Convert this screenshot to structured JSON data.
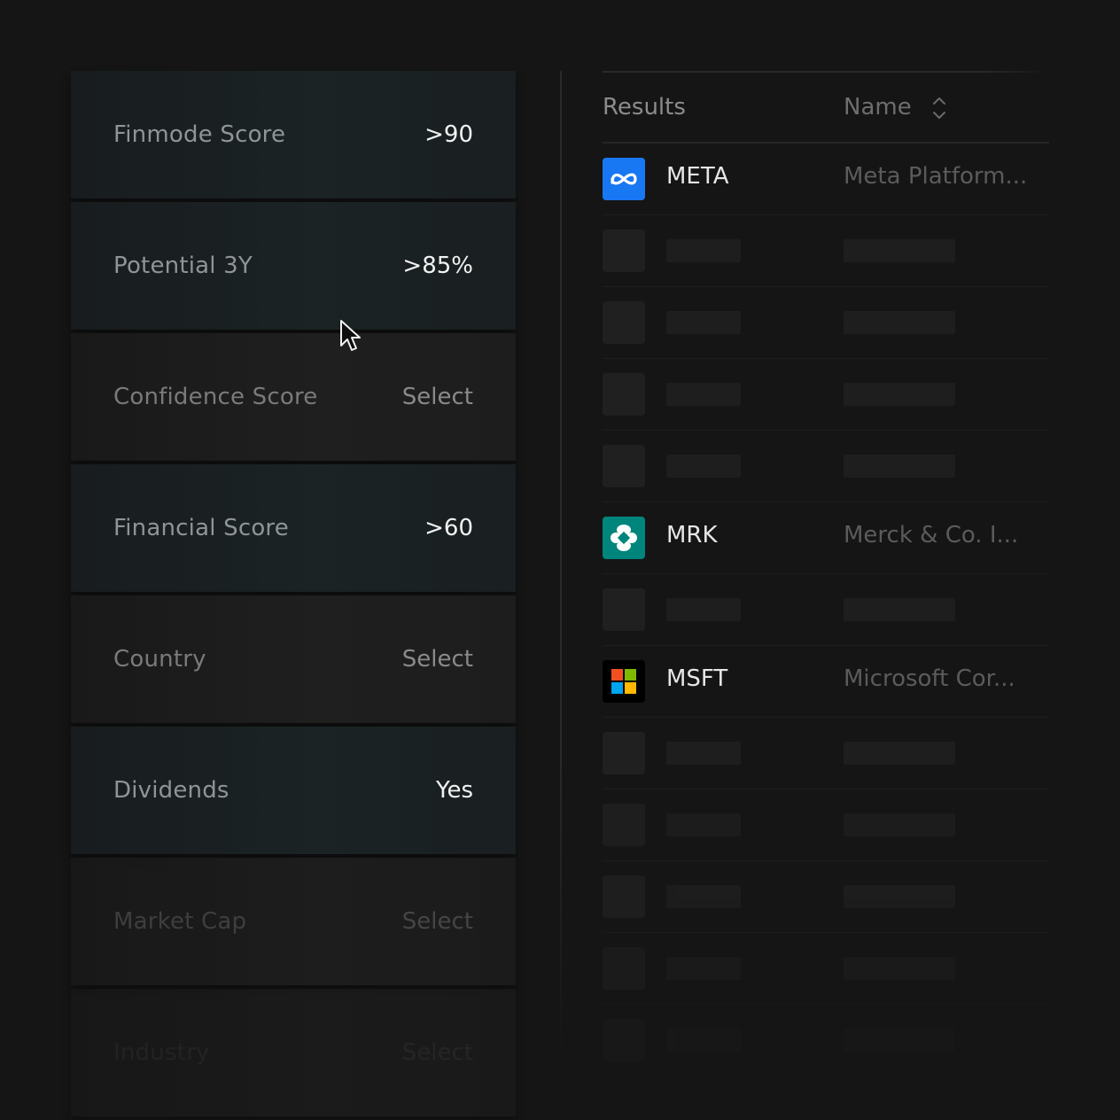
{
  "filters": [
    {
      "label": "Finmode Score",
      "value": ">90",
      "state": "active"
    },
    {
      "label": "Potential 3Y",
      "value": ">85%",
      "state": "active"
    },
    {
      "label": "Confidence Score",
      "value": "Select",
      "state": "inactive"
    },
    {
      "label": "Financial Score",
      "value": ">60",
      "state": "active"
    },
    {
      "label": "Country",
      "value": "Select",
      "state": "inactive"
    },
    {
      "label": "Dividends",
      "value": "Yes",
      "state": "active"
    },
    {
      "label": "Market Cap",
      "value": "Select",
      "state": "inactive"
    },
    {
      "label": "Industry",
      "value": "Select",
      "state": "inactive"
    }
  ],
  "results": {
    "header_results": "Results",
    "header_name": "Name",
    "sort_icon": "sort-updown-icon",
    "rows": [
      {
        "ticker": "META",
        "name": "Meta Platform...",
        "logo": "meta-logo-icon"
      },
      {
        "placeholder": true
      },
      {
        "placeholder": true
      },
      {
        "placeholder": true
      },
      {
        "placeholder": true
      },
      {
        "ticker": "MRK",
        "name": "Merck & Co. I...",
        "logo": "merck-logo-icon"
      },
      {
        "placeholder": true
      },
      {
        "ticker": "MSFT",
        "name": "Microsoft Cor...",
        "logo": "microsoft-logo-icon"
      },
      {
        "placeholder": true
      },
      {
        "placeholder": true
      },
      {
        "placeholder": true
      },
      {
        "placeholder": true
      },
      {
        "placeholder": true
      }
    ]
  },
  "colors": {
    "background": "#151515",
    "active_row": "#1b2325",
    "meta_blue": "#1877f2",
    "merck_teal": "#00857c"
  }
}
